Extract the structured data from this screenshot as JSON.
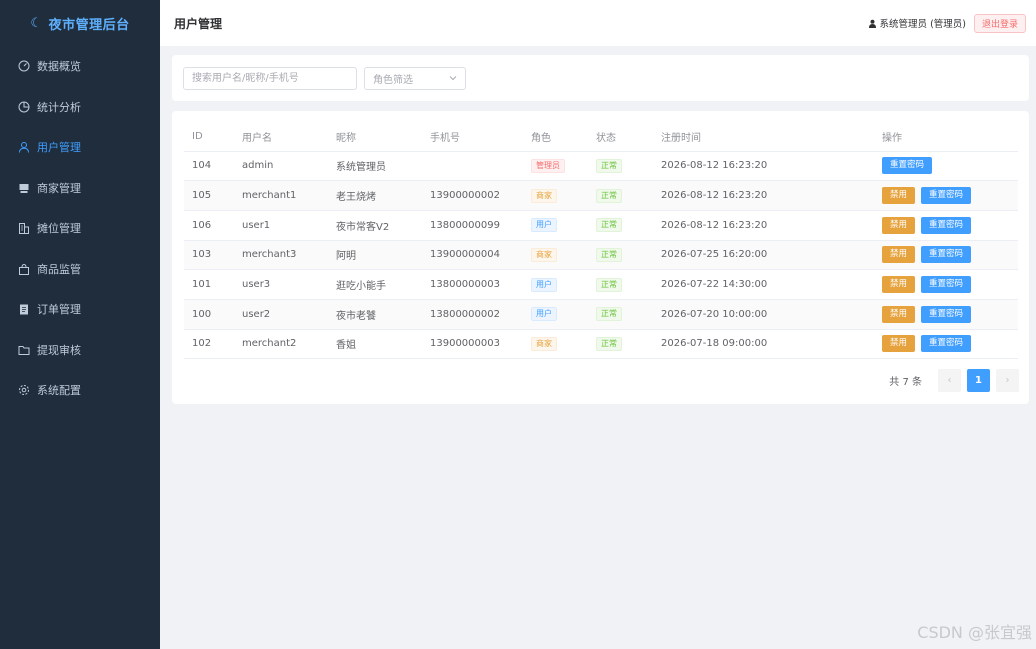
{
  "app": {
    "brand": "夜市管理后台"
  },
  "sidebar": {
    "items": [
      {
        "label": "数据概览",
        "icon": "dashboard-icon",
        "active": false
      },
      {
        "label": "统计分析",
        "icon": "pie-chart-icon",
        "active": false
      },
      {
        "label": "用户管理",
        "icon": "user-icon",
        "active": true
      },
      {
        "label": "商家管理",
        "icon": "shop-icon",
        "active": false
      },
      {
        "label": "摊位管理",
        "icon": "building-icon",
        "active": false
      },
      {
        "label": "商品监管",
        "icon": "goods-icon",
        "active": false
      },
      {
        "label": "订单管理",
        "icon": "order-icon",
        "active": false
      },
      {
        "label": "提现审核",
        "icon": "folder-icon",
        "active": false
      },
      {
        "label": "系统配置",
        "icon": "settings-icon",
        "active": false
      }
    ]
  },
  "header": {
    "title": "用户管理",
    "user": "系统管理员 (管理员)",
    "logout_label": "退出登录"
  },
  "filters": {
    "search_placeholder": "搜索用户名/昵称/手机号",
    "role_placeholder": "角色筛选"
  },
  "table": {
    "columns": [
      "ID",
      "用户名",
      "昵称",
      "手机号",
      "角色",
      "状态",
      "注册时间",
      "操作"
    ],
    "rows": [
      {
        "id": "104",
        "username": "admin",
        "nickname": "系统管理员",
        "phone": "",
        "role": "管理员",
        "role_type": "admin",
        "status": "正常",
        "created": "2026-08-12 16:23:20",
        "actions": [
          "重置密码"
        ]
      },
      {
        "id": "105",
        "username": "merchant1",
        "nickname": "老王烧烤",
        "phone": "13900000002",
        "role": "商家",
        "role_type": "merchant",
        "status": "正常",
        "created": "2026-08-12 16:23:20",
        "actions": [
          "禁用",
          "重置密码"
        ]
      },
      {
        "id": "106",
        "username": "user1",
        "nickname": "夜市常客V2",
        "phone": "13800000099",
        "role": "用户",
        "role_type": "user",
        "status": "正常",
        "created": "2026-08-12 16:23:20",
        "actions": [
          "禁用",
          "重置密码"
        ]
      },
      {
        "id": "103",
        "username": "merchant3",
        "nickname": "阿明",
        "phone": "13900000004",
        "role": "商家",
        "role_type": "merchant",
        "status": "正常",
        "created": "2026-07-25 16:20:00",
        "actions": [
          "禁用",
          "重置密码"
        ]
      },
      {
        "id": "101",
        "username": "user3",
        "nickname": "逛吃小能手",
        "phone": "13800000003",
        "role": "用户",
        "role_type": "user",
        "status": "正常",
        "created": "2026-07-22 14:30:00",
        "actions": [
          "禁用",
          "重置密码"
        ]
      },
      {
        "id": "100",
        "username": "user2",
        "nickname": "夜市老饕",
        "phone": "13800000002",
        "role": "用户",
        "role_type": "user",
        "status": "正常",
        "created": "2026-07-20 10:00:00",
        "actions": [
          "禁用",
          "重置密码"
        ]
      },
      {
        "id": "102",
        "username": "merchant2",
        "nickname": "香姐",
        "phone": "13900000003",
        "role": "商家",
        "role_type": "merchant",
        "status": "正常",
        "created": "2026-07-18 09:00:00",
        "actions": [
          "禁用",
          "重置密码"
        ]
      }
    ]
  },
  "pagination": {
    "total_text": "共 7 条",
    "prev": "‹",
    "current": "1",
    "next": "›"
  },
  "watermark": "CSDN @张宜强",
  "colors": {
    "sidebar_bg": "#1f2d3d",
    "accent": "#409eff",
    "warning": "#e6a23c",
    "danger": "#f56c6c",
    "success": "#67c23a"
  }
}
